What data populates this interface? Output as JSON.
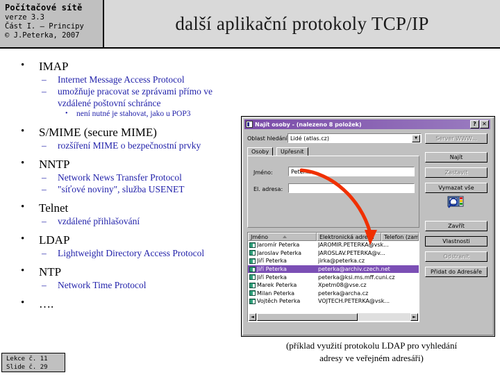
{
  "header": {
    "course_title": "Počítačové sítě",
    "version": "verze 3.3",
    "part": "Část I. – Principy",
    "copyright": "© J.Peterka, 2007",
    "slide_title": "další aplikační protokoly TCP/IP"
  },
  "bullets": {
    "imap": "IMAP",
    "imap_sub1": "Internet Message Access Protocol",
    "imap_sub2": "umožňuje pracovat se zprávami přímo ve vzdálené poštovní schránce",
    "imap_sub2_sub": "není nutné je stahovat, jako u POP3",
    "smime": "S/MIME (secure MIME)",
    "smime_sub1": "rozšíření MIME o bezpečnostní prvky",
    "nntp": "NNTP",
    "nntp_sub1": "Network News Transfer Protocol",
    "nntp_sub2": "\"síťové noviny\", služba USENET",
    "telnet": "Telnet",
    "telnet_sub1": "vzdálené přihlašování",
    "ldap": "LDAP",
    "ldap_sub1": "Lightweight Directory Access Protocol",
    "ntp": "NTP",
    "ntp_sub1": "Network Time Protocol",
    "more": "…."
  },
  "dialog": {
    "title": "Najít osoby - (nalezeno 8 položek)",
    "help_button": "?",
    "close_button": "✕",
    "scope_label": "Oblast hledání:",
    "scope_value": "Lidé (atlas.cz)",
    "scope_arrow": "▼",
    "tabs": [
      {
        "label": "Osoby"
      },
      {
        "label": "Upřesnit"
      }
    ],
    "fields": [
      {
        "label": "Jméno:",
        "value": "Peterka"
      },
      {
        "label": "El. adresa:",
        "value": ""
      }
    ],
    "buttons": [
      {
        "label": "Server WWW...",
        "state": "disabled"
      },
      {
        "label": "Najít",
        "state": "enabled"
      },
      {
        "label": "Zastavit",
        "state": "disabled"
      },
      {
        "label": "Vymazat vše",
        "state": "enabled"
      },
      {
        "label": "Zavřít",
        "state": "enabled"
      },
      {
        "label": "Vlastnosti",
        "state": "default"
      },
      {
        "label": "Odstranit",
        "state": "disabled"
      },
      {
        "label": "Přidat do Adresáře",
        "state": "enabled"
      }
    ],
    "columns": [
      "Jméno",
      "Elektronická adresa",
      "Telefon (zam."
    ],
    "rows": [
      {
        "name": "Jaromír Peterka",
        "email": "JAROMIR.PETERKA@vsk...",
        "selected": false
      },
      {
        "name": "Jaroslav Peterka",
        "email": "JAROSLAV.PETERKA@v...",
        "selected": false
      },
      {
        "name": "Jiří Peterka",
        "email": "jirka@peterka.cz",
        "selected": false
      },
      {
        "name": "Jiří Peterka",
        "email": "peterka@archiv.czech.net",
        "selected": true
      },
      {
        "name": "Jiří Peterka",
        "email": "peterka@ksi.ms.mff.cuni.cz",
        "selected": false
      },
      {
        "name": "Marek Peterka",
        "email": "Xpetm08@vse.cz",
        "selected": false
      },
      {
        "name": "Milan Peterka",
        "email": "peterka@archa.cz",
        "selected": false
      },
      {
        "name": "Vojtěch Peterka",
        "email": "VOJTECH.PETERKA@vsk...",
        "selected": false
      }
    ],
    "scroll_left": "◄",
    "scroll_right": "►"
  },
  "caption": {
    "line1": "(příklad využití protokolu LDAP pro vyhledání",
    "line2": "adresy ve veřejném  adresáři)"
  },
  "footer": {
    "lesson": "Lekce č. 11",
    "slide": "Slide č. 29"
  },
  "colors": {
    "header_band": "#d9d9d9",
    "course_box": "#c0c0c0",
    "sub_bullet_text": "#2222aa",
    "dialog_face": "#c0c0c0",
    "titlebar": "#7a4ba8",
    "selection": "#7b4fb5",
    "arrow": "#f03000"
  }
}
